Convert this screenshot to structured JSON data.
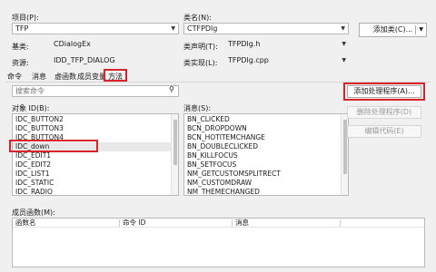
{
  "project": {
    "label": "项目(P):",
    "value": "TFP"
  },
  "classname": {
    "label": "类名(N):",
    "value": "CTFPDlg"
  },
  "add_class_button": "添加类(C)...",
  "base": {
    "label": "基类:",
    "value": "CDialogEx"
  },
  "header_file": {
    "label": "类声明(T):",
    "value": "TFPDlg.h"
  },
  "resource": {
    "label": "资源:",
    "value": "IDD_TFP_DIALOG"
  },
  "impl_file": {
    "label": "类实现(L):",
    "value": "TFPDlg.cpp"
  },
  "tabs": [
    {
      "label": "命令"
    },
    {
      "label": "消息"
    },
    {
      "label": "虚函数"
    },
    {
      "label": "成员变量"
    },
    {
      "label": "方法"
    }
  ],
  "search": {
    "placeholder": "搜索命令"
  },
  "object_ids": {
    "label": "对象 ID(B):",
    "items": [
      "IDC_BUTTON2",
      "IDC_BUTTON3",
      "IDC_BUTTON4",
      "IDC_down",
      "IDC_EDIT1",
      "IDC_EDIT2",
      "IDC_LIST1",
      "IDC_STATIC",
      "IDC_RADIO"
    ],
    "selected": "IDC_down"
  },
  "messages": {
    "label": "消息(S):",
    "items": [
      "BN_CLICKED",
      "BCN_DROPDOWN",
      "BCN_HOTITEMCHANGE",
      "BN_DOUBLECLICKED",
      "BN_KILLFOCUS",
      "BN_SETFOCUS",
      "NM_GETCUSTOMSPLITRECT",
      "NM_CUSTOMDRAW",
      "NM_THEMECHANGED"
    ]
  },
  "buttons": {
    "add_handler": "添加处理程序(A)...",
    "delete_handler": "删除处理程序(D)",
    "edit_code": "编辑代码(E)"
  },
  "member_functions": {
    "label": "成员函数(M):",
    "columns": [
      "函数名",
      "命令 ID",
      "消息"
    ]
  }
}
